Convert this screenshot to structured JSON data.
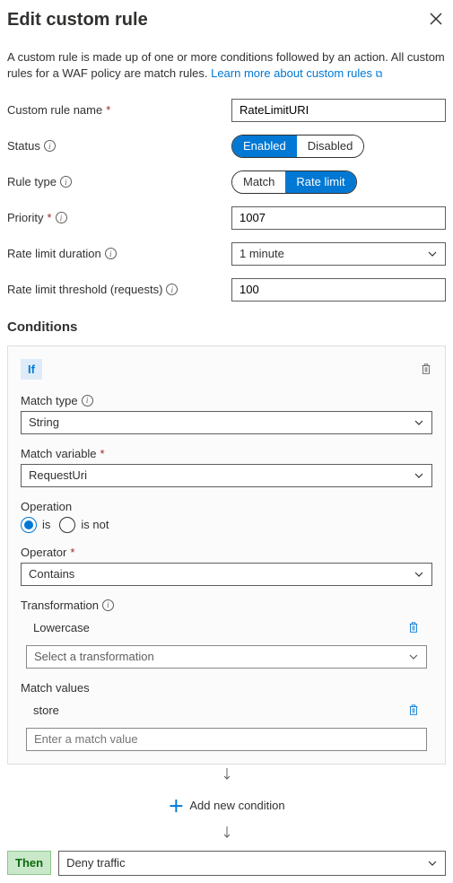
{
  "header": {
    "title": "Edit custom rule"
  },
  "description": {
    "text": "A custom rule is made up of one or more conditions followed by an action. All custom rules for a WAF policy are match rules. ",
    "link_text": "Learn more about custom rules"
  },
  "form": {
    "name_label": "Custom rule name",
    "name_value": "RateLimitURI",
    "status_label": "Status",
    "status_enabled": "Enabled",
    "status_disabled": "Disabled",
    "rule_type_label": "Rule type",
    "rule_type_match": "Match",
    "rule_type_rate": "Rate limit",
    "priority_label": "Priority",
    "priority_value": "1007",
    "duration_label": "Rate limit duration",
    "duration_value": "1 minute",
    "threshold_label": "Rate limit threshold (requests)",
    "threshold_value": "100"
  },
  "conditions": {
    "title": "Conditions",
    "if_label": "If",
    "match_type_label": "Match type",
    "match_type_value": "String",
    "match_variable_label": "Match variable",
    "match_variable_value": "RequestUri",
    "operation_label": "Operation",
    "operation_is": "is",
    "operation_isnot": "is not",
    "operator_label": "Operator",
    "operator_value": "Contains",
    "transformation_label": "Transformation",
    "transformation_value": "Lowercase",
    "transformation_placeholder": "Select a transformation",
    "match_values_label": "Match values",
    "match_value_item": "store",
    "match_value_placeholder": "Enter a match value",
    "add_condition": "Add new condition"
  },
  "action": {
    "then_label": "Then",
    "action_value": "Deny traffic"
  }
}
